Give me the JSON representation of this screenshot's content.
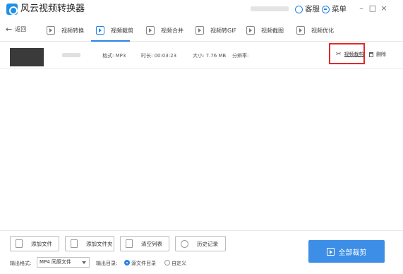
{
  "app": {
    "title": "风云视频转换器"
  },
  "titlebar": {
    "service_label": "客服",
    "menu_label": "菜单",
    "minimize": "–",
    "maximize": "□",
    "close": "×"
  },
  "nav": {
    "back_label": "返回",
    "tabs": [
      {
        "label": "视频转换",
        "icon": "video-convert-icon"
      },
      {
        "label": "视频裁剪",
        "icon": "video-cut-icon",
        "active": true
      },
      {
        "label": "视频合并",
        "icon": "video-merge-icon"
      },
      {
        "label": "视频转GIF",
        "icon": "gif-icon"
      },
      {
        "label": "视频截图",
        "icon": "screenshot-icon"
      },
      {
        "label": "视频优化",
        "icon": "optimize-icon"
      }
    ]
  },
  "file": {
    "format": "格式: MP3",
    "duration": "时长: 00:03:23",
    "size": "大小: 7.76 MB",
    "resolution": "分辨率:",
    "cut_label": "视频裁剪",
    "delete_label": "删除"
  },
  "bottom": {
    "buttons": [
      "添加文件",
      "添加文件夹",
      "清空列表",
      "历史记录"
    ],
    "output_format_label": "输出格式:",
    "output_format_value": "MP4 同原文件",
    "output_dir_label": "输出目录:",
    "dir_options": [
      "源文件目录",
      "自定义"
    ],
    "primary_label": "全部裁剪"
  },
  "colors": {
    "accent": "#3c8ee6",
    "highlight": "#e02a2a"
  }
}
